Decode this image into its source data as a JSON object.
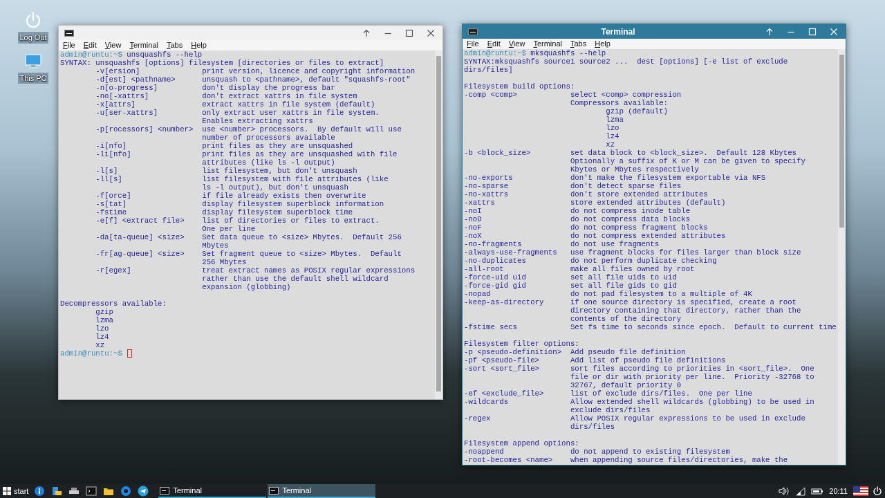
{
  "desktop_icons": [
    {
      "kind": "power",
      "label": "Log Out"
    },
    {
      "kind": "computer",
      "label": "This PC"
    }
  ],
  "windows": [
    {
      "active": false,
      "menu": [
        "File",
        "Edit",
        "View",
        "Terminal",
        "Tabs",
        "Help"
      ],
      "lines": [
        {
          "kind": "prompt",
          "prompt": "admin@runtu:~$",
          "command": "unsquashfs --help",
          "cursor": false
        },
        {
          "kind": "text",
          "text": "SYNTAX: unsquashfs [options] filesystem [directories or files to extract]"
        },
        {
          "kind": "option",
          "option": "-v[ersion]",
          "description": "print version, licence and copyright information"
        },
        {
          "kind": "option",
          "option": "-d[est] <pathname>",
          "description": "unsquash to <pathname>, default \"squashfs-root\""
        },
        {
          "kind": "option",
          "option": "-n[o-progress]",
          "description": "don't display the progress bar"
        },
        {
          "kind": "option",
          "option": "-no[-xattrs]",
          "description": "don't extract xattrs in file system"
        },
        {
          "kind": "option",
          "option": "-x[attrs]",
          "description": "extract xattrs in file system (default)"
        },
        {
          "kind": "option",
          "option": "-u[ser-xattrs]",
          "description": "only extract user xattrs in file system."
        },
        {
          "kind": "option",
          "description": "Enables extracting xattrs"
        },
        {
          "kind": "option",
          "option": "-p[rocessors] <number>",
          "description": "use <number> processors.  By default will use"
        },
        {
          "kind": "option",
          "description": "number of processors available"
        },
        {
          "kind": "option",
          "option": "-i[nfo]",
          "description": "print files as they are unsquashed"
        },
        {
          "kind": "option",
          "option": "-li[nfo]",
          "description": "print files as they are unsquashed with file"
        },
        {
          "kind": "option",
          "description": "attributes (like ls -l output)"
        },
        {
          "kind": "option",
          "option": "-l[s]",
          "description": "list filesystem, but don't unsquash"
        },
        {
          "kind": "option",
          "option": "-ll[s]",
          "description": "list filesystem with file attributes (like"
        },
        {
          "kind": "option",
          "description": "ls -l output), but don't unsquash"
        },
        {
          "kind": "option",
          "option": "-f[orce]",
          "description": "if file already exists then overwrite"
        },
        {
          "kind": "option",
          "option": "-s[tat]",
          "description": "display filesystem superblock information"
        },
        {
          "kind": "option",
          "option": "-fstime",
          "description": "display filesystem superblock time"
        },
        {
          "kind": "option",
          "option": "-e[f] <extract file>",
          "description": "list of directories or files to extract."
        },
        {
          "kind": "option",
          "description": "One per line"
        },
        {
          "kind": "option",
          "option": "-da[ta-queue] <size>",
          "description": "Set data queue to <size> Mbytes.  Default 256"
        },
        {
          "kind": "option",
          "description": "Mbytes"
        },
        {
          "kind": "option",
          "option": "-fr[ag-queue] <size>",
          "description": "Set fragment queue to <size> Mbytes.  Default"
        },
        {
          "kind": "option",
          "description": "256 Mbytes"
        },
        {
          "kind": "option",
          "option": "-r[egex]",
          "description": "treat extract names as POSIX regular expressions"
        },
        {
          "kind": "option",
          "description": "rather than use the default shell wildcard"
        },
        {
          "kind": "option",
          "description": "expansion (globbing)"
        },
        {
          "kind": "blank"
        },
        {
          "kind": "text",
          "text": "Decompressors available:"
        },
        {
          "kind": "item",
          "text": "gzip"
        },
        {
          "kind": "item",
          "text": "lzma"
        },
        {
          "kind": "item",
          "text": "lzo"
        },
        {
          "kind": "item",
          "text": "lz4"
        },
        {
          "kind": "item",
          "text": "xz"
        },
        {
          "kind": "prompt",
          "prompt": "admin@runtu:~$",
          "cursor": true
        }
      ]
    },
    {
      "active": true,
      "title": "Terminal",
      "menu": [
        "File",
        "Edit",
        "View",
        "Terminal",
        "Tabs",
        "Help"
      ],
      "lines": [
        {
          "kind": "prompt",
          "prompt": "admin@runtu:~$",
          "command": "mksquashfs --help",
          "cursor": false
        },
        {
          "kind": "text",
          "text": "SYNTAX:mksquashfs source1 source2 ...  dest [options] [-e list of exclude"
        },
        {
          "kind": "text",
          "text": "dirs/files]"
        },
        {
          "kind": "blank"
        },
        {
          "kind": "text",
          "text": "Filesystem build options:"
        },
        {
          "kind": "option",
          "option": "-comp <comp>",
          "description": "select <comp> compression"
        },
        {
          "kind": "option",
          "description": "Compressors available:"
        },
        {
          "kind": "item",
          "text": "gzip (default)"
        },
        {
          "kind": "item",
          "text": "lzma"
        },
        {
          "kind": "item",
          "text": "lzo"
        },
        {
          "kind": "item",
          "text": "lz4"
        },
        {
          "kind": "item",
          "text": "xz"
        },
        {
          "kind": "option",
          "option": "-b <block_size>",
          "description": "set data block to <block_size>.  Default 128 Kbytes"
        },
        {
          "kind": "option",
          "description": "Optionally a suffix of K or M can be given to specify"
        },
        {
          "kind": "option",
          "description": "Kbytes or Mbytes respectively"
        },
        {
          "kind": "option",
          "option": "-no-exports",
          "description": "don't make the filesystem exportable via NFS"
        },
        {
          "kind": "option",
          "option": "-no-sparse",
          "description": "don't detect sparse files"
        },
        {
          "kind": "option",
          "option": "-no-xattrs",
          "description": "don't store extended attributes"
        },
        {
          "kind": "option",
          "option": "-xattrs",
          "description": "store extended attributes (default)"
        },
        {
          "kind": "option",
          "option": "-noI",
          "description": "do not compress inode table"
        },
        {
          "kind": "option",
          "option": "-noD",
          "description": "do not compress data blocks"
        },
        {
          "kind": "option",
          "option": "-noF",
          "description": "do not compress fragment blocks"
        },
        {
          "kind": "option",
          "option": "-noX",
          "description": "do not compress extended attributes"
        },
        {
          "kind": "option",
          "option": "-no-fragments",
          "description": "do not use fragments"
        },
        {
          "kind": "option",
          "option": "-always-use-fragments",
          "description": "use fragment blocks for files larger than block size"
        },
        {
          "kind": "option",
          "option": "-no-duplicates",
          "description": "do not perform duplicate checking"
        },
        {
          "kind": "option",
          "option": "-all-root",
          "description": "make all files owned by root"
        },
        {
          "kind": "option",
          "option": "-force-uid uid",
          "description": "set all file uids to uid"
        },
        {
          "kind": "option",
          "option": "-force-gid gid",
          "description": "set all file gids to gid"
        },
        {
          "kind": "option",
          "option": "-nopad",
          "description": "do not pad filesystem to a multiple of 4K"
        },
        {
          "kind": "option",
          "option": "-keep-as-directory",
          "description": "if one source directory is specified, create a root"
        },
        {
          "kind": "option",
          "description": "directory containing that directory, rather than the"
        },
        {
          "kind": "option",
          "description": "contents of the directory"
        },
        {
          "kind": "option",
          "option": "-fstime secs",
          "description": "Set fs time to seconds since epoch.  Default to current time"
        },
        {
          "kind": "blank"
        },
        {
          "kind": "text",
          "text": "Filesystem filter options:"
        },
        {
          "kind": "option",
          "option": "-p <pseudo-definition>",
          "description": "Add pseudo file definition"
        },
        {
          "kind": "option",
          "option": "-pf <pseudo-file>",
          "description": "Add list of pseudo file definitions"
        },
        {
          "kind": "option",
          "option": "-sort <sort_file>",
          "description": "sort files according to priorities in <sort_file>.  One"
        },
        {
          "kind": "option",
          "description": "file or dir with priority per line.  Priority -32768 to"
        },
        {
          "kind": "option",
          "description": "32767, default priority 0"
        },
        {
          "kind": "option",
          "option": "-ef <exclude_file>",
          "description": "list of exclude dirs/files.  One per line"
        },
        {
          "kind": "option",
          "option": "-wildcards",
          "description": "Allow extended shell wildcards (globbing) to be used in"
        },
        {
          "kind": "option",
          "description": "exclude dirs/files"
        },
        {
          "kind": "option",
          "option": "-regex",
          "description": "Allow POSIX regular expressions to be used in exclude"
        },
        {
          "kind": "option",
          "description": "dirs/files"
        },
        {
          "kind": "blank"
        },
        {
          "kind": "text",
          "text": "Filesystem append options:"
        },
        {
          "kind": "option",
          "option": "-noappend",
          "description": "do not append to existing filesystem"
        },
        {
          "kind": "option",
          "option": "-root-becomes <name>",
          "description": "when appending source files/directories, make the"
        }
      ]
    }
  ],
  "taskbar": {
    "start_label": "start",
    "tasks": [
      {
        "label": "Terminal",
        "selected": false
      },
      {
        "label": "Terminal",
        "selected": true
      }
    ],
    "clock": "20:11"
  }
}
